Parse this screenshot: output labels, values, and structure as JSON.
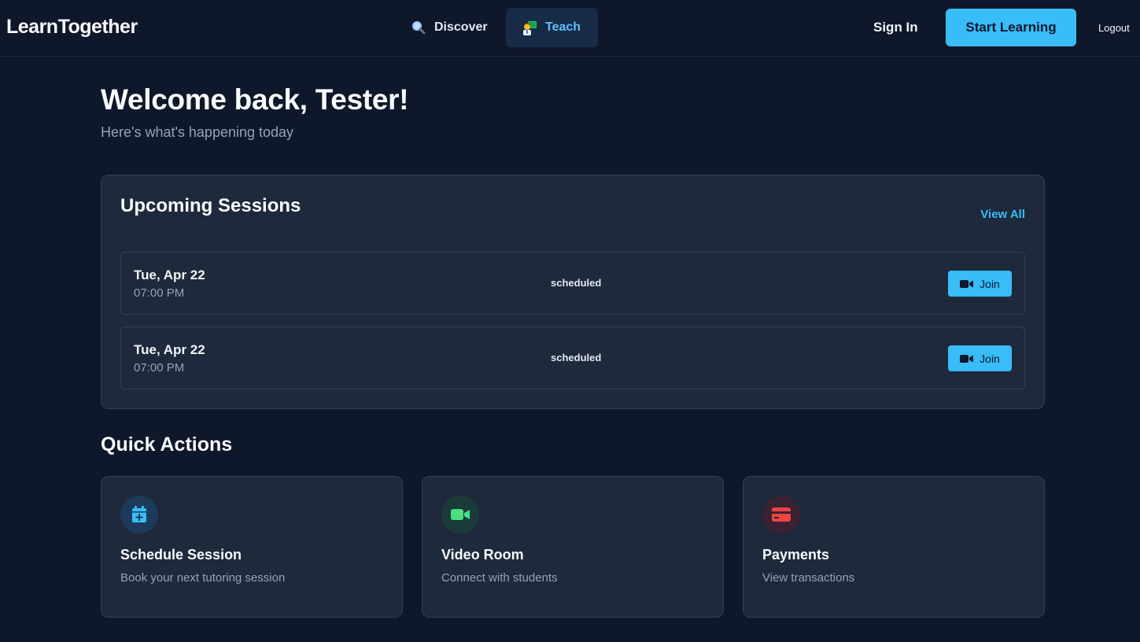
{
  "header": {
    "brand": "LearnTogether",
    "nav": [
      {
        "label": "Discover",
        "icon": "magnifying-glass-icon"
      },
      {
        "label": "Teach",
        "icon": "teacher-icon"
      }
    ],
    "sign_in": "Sign In",
    "start_learning": "Start Learning",
    "logout": "Logout"
  },
  "welcome": {
    "title": "Welcome back, Tester!",
    "subtitle": "Here's what's happening today"
  },
  "sessions": {
    "title": "Upcoming Sessions",
    "view_all": "View All",
    "items": [
      {
        "date": "Tue, Apr 22",
        "time": "07:00 PM",
        "status": "scheduled",
        "action": "Join"
      },
      {
        "date": "Tue, Apr 22",
        "time": "07:00 PM",
        "status": "scheduled",
        "action": "Join"
      }
    ]
  },
  "quick_actions": {
    "title": "Quick Actions",
    "cards": [
      {
        "title": "Schedule Session",
        "description": "Book your next tutoring session",
        "icon": "calendar-plus-icon",
        "color": "#38bdf8"
      },
      {
        "title": "Video Room",
        "description": "Connect with students",
        "icon": "video-camera-icon",
        "color": "#4ade80"
      },
      {
        "title": "Payments",
        "description": "View transactions",
        "icon": "credit-card-icon",
        "color": "#ef4444"
      }
    ]
  },
  "colors": {
    "background": "#0f172a",
    "panel": "#1e293b",
    "accent": "#38bdf8",
    "muted_text": "#94a3b8"
  }
}
